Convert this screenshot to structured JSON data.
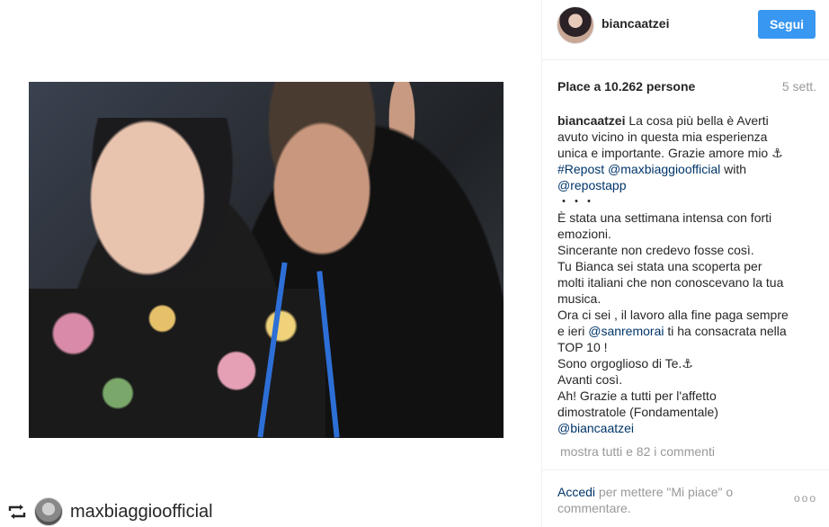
{
  "post": {
    "username": "biancaatzei",
    "follow_label": "Segui",
    "likes_text": "Place a 10.262 persone",
    "time_ago": "5 sett."
  },
  "caption": {
    "author": "biancaatzei",
    "line1": "La cosa più bella è Averti",
    "line2": "avuto vicino in questa mia esperienza",
    "line3": "unica e importante. Grazie amore mio ⚓",
    "line4a": "#Repost @maxbiaggioofficial",
    "line4b": " with",
    "line5": "@repostapp",
    "line6": "・・・",
    "line7": "È stata una settimana intensa con forti",
    "line8": "emozioni.",
    "line9": "Sincerante non credevo fosse così.",
    "line10": "Tu Bianca sei stata una scoperta per",
    "line11": "molti italiani che non conoscevano la tua",
    "line12": "musica.",
    "line13": "Ora ci sei , il lavoro alla fine paga sempre",
    "line14a": "e ieri ",
    "line14b": "@sanremorai",
    "line14c": " ti ha consacrata nella",
    "line15": "TOP 10 !",
    "line16": "Sono orgoglioso di Te.⚓",
    "line17": "Avanti così.",
    "line18": "Ah! Grazie a tutti per l'affetto",
    "line19": "dimostratole (Fondamentale)",
    "line20": "@biancaatzei"
  },
  "comments_link": "mostra tutti e 82 i commenti",
  "footer": {
    "login_label": "Accedi",
    "rest": " per mettere \"Mi piace\" o commentare.",
    "more_label": "ooo"
  },
  "repost": {
    "username": "maxbiaggioofficial",
    "icon": "repost-icon"
  },
  "colors": {
    "follow_bg": "#3897f0",
    "link": "#003569",
    "muted": "#999999"
  }
}
